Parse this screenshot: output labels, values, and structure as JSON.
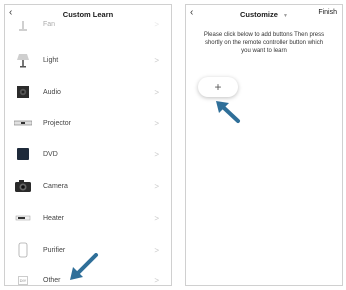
{
  "left_screen": {
    "back_icon": "chevron-left-icon",
    "title": "Custom Learn",
    "devices": [
      {
        "label": "Fan",
        "icon": "fan-icon"
      },
      {
        "label": "Light",
        "icon": "lamp-icon"
      },
      {
        "label": "Audio",
        "icon": "speaker-icon"
      },
      {
        "label": "Projector",
        "icon": "projector-icon"
      },
      {
        "label": "DVD",
        "icon": "dvd-player-icon"
      },
      {
        "label": "Camera",
        "icon": "camera-icon"
      },
      {
        "label": "Heater",
        "icon": "heater-icon"
      },
      {
        "label": "Purifier",
        "icon": "purifier-icon"
      },
      {
        "label": "Other",
        "icon": "diy-icon",
        "icon_text": "DIY"
      }
    ],
    "chevron": ">"
  },
  "right_screen": {
    "back_icon": "chevron-left-icon",
    "title": "Customize",
    "title_caret_icon": "caret-down-icon",
    "finish_label": "Finish",
    "instructions": "Please click below to add buttons Then press shortly on the remote controller button which you want to learn",
    "add_button_label": "+"
  },
  "annotations": {
    "arrow_color": "#2f6f99",
    "arrow_icon": "pointer-arrow-icon"
  }
}
